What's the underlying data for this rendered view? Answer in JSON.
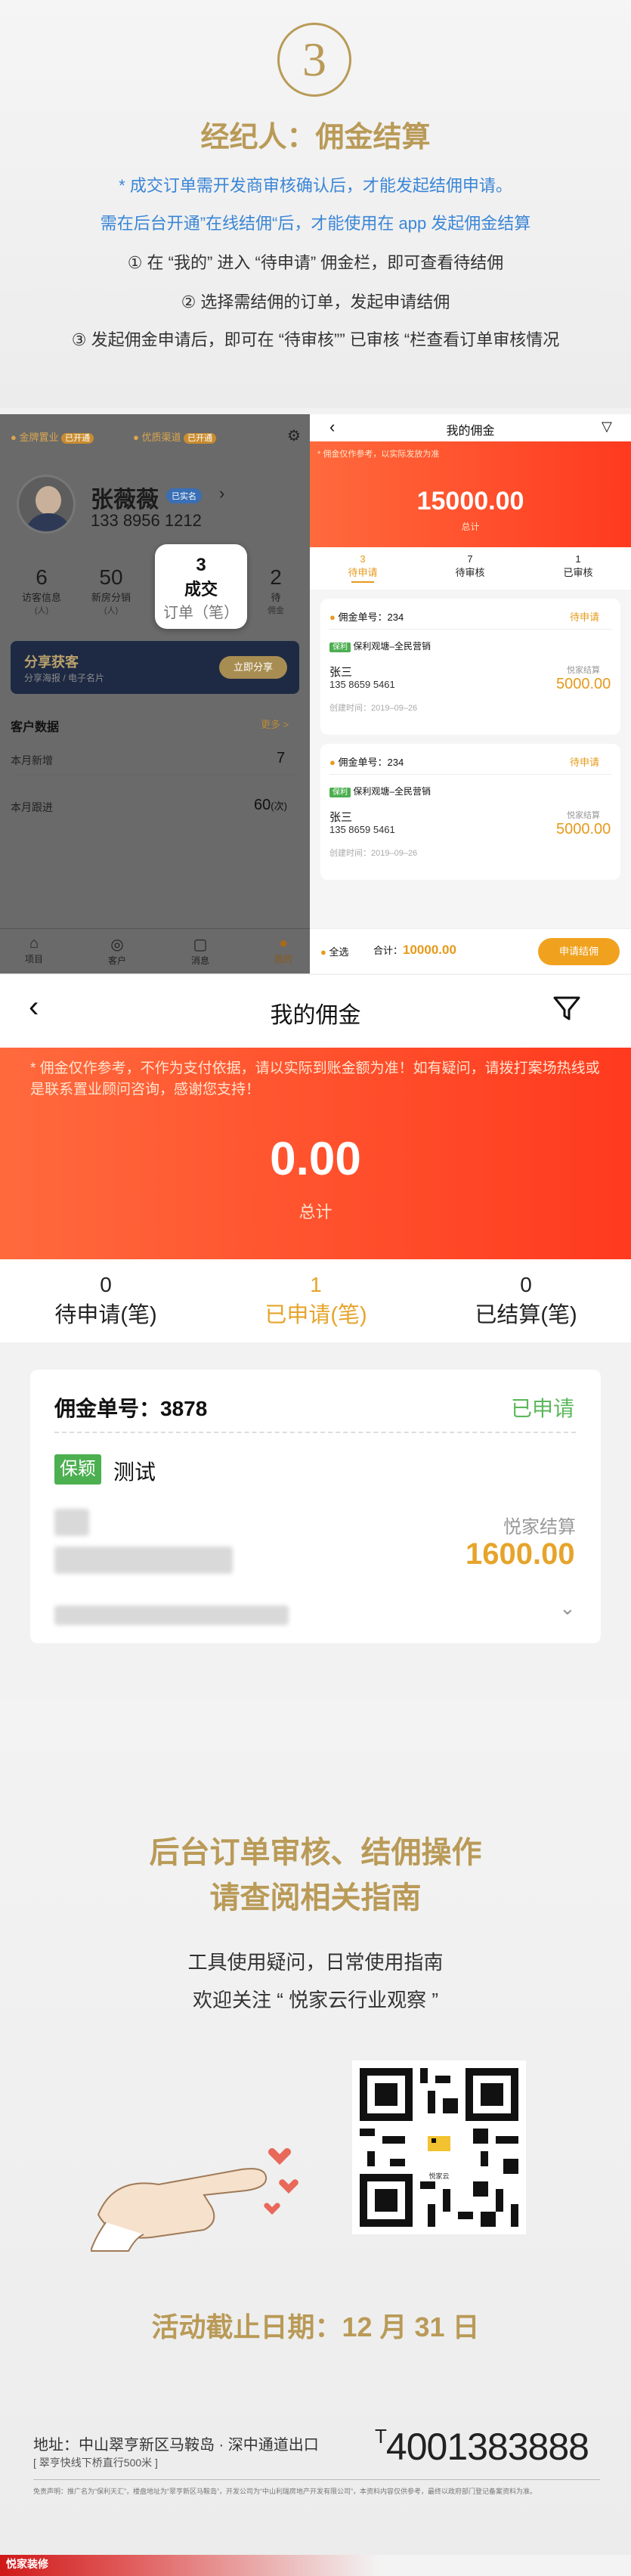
{
  "header": {
    "step_number": "3",
    "title": "经纪人：佣金结算",
    "note1": "* 成交订单需开发商审核确认后，才能发起结佣申请。",
    "note2": "需在后台开通”在线结佣“后，才能使用在 app 发起佣金结算",
    "step1": "① 在 “我的” 进入 “待申请” 佣金栏，即可查看待结佣",
    "step2": "② 选择需结佣的订单，发起申请结佣",
    "step3": "③ 发起佣金申请后，即可在 “待审核”” 已审核 “栏查看订单审核情况"
  },
  "left_phone": {
    "badge1": "金牌置业",
    "badge1_tag": "已开通",
    "badge2": "优质渠道",
    "badge2_tag": "已开通",
    "name": "张薇薇",
    "role_tag": "已实名",
    "phone": "133 8956 1212",
    "stats": [
      {
        "value": "6",
        "label": "访客信息",
        "sub": "(人)"
      },
      {
        "value": "50",
        "label": "新房分销",
        "sub": "(人)"
      },
      {
        "value": "3",
        "label": "成交",
        "sub": "订单（笔）"
      },
      {
        "value": "2",
        "label": "待",
        "sub": "佣金"
      }
    ],
    "share_title": "分享获客",
    "share_sub": "分享海报 / 电子名片",
    "share_btn": "立即分享",
    "customer_data": "客户数据",
    "more": "更多 >",
    "row1_label": "本月新增",
    "row1_value": "7",
    "row2_label": "本月跟进",
    "row2_value": "60",
    "row2_unit": "(次)",
    "tabs": [
      "项目",
      "客户",
      "消息",
      "我的"
    ]
  },
  "right_phone": {
    "title": "我的佣金",
    "notice": "* 佣金仅作参考，以实际发放为准",
    "amount": "15000.00",
    "amount_label": "总计",
    "tabs": [
      {
        "count": "3",
        "label": "待申请"
      },
      {
        "count": "7",
        "label": "待审核"
      },
      {
        "count": "1",
        "label": "已审核"
      }
    ],
    "items": [
      {
        "order": "佣金单号：234",
        "status": "待申请",
        "tag": "保利",
        "project": "保利观塘–全民营销",
        "client": "张三",
        "phone": "135 8659 5461",
        "pay_label": "悦家结算",
        "pay": "5000.00",
        "date": "创建时间：2019–09–26"
      },
      {
        "order": "佣金单号：234",
        "status": "待申请",
        "tag": "保利",
        "project": "保利观塘–全民营销",
        "client": "张三",
        "phone": "135 8659 5461",
        "pay_label": "悦家结算",
        "pay": "5000.00",
        "date": "创建时间：2019–09–26"
      }
    ],
    "select_all": "全选",
    "total_label": "合计：",
    "total": "10000.00",
    "apply_btn": "申请结佣"
  },
  "main": {
    "title": "我的佣金",
    "notice": "* 佣金仅作参考，不作为支付依据，请以实际到账金额为准！如有疑问，请拨打案场热线或是联系置业顾问咨询，感谢您支持！",
    "amount": "0.00",
    "amount_label": "总计",
    "tabs": [
      {
        "count": "0",
        "label": "待申请(笔)"
      },
      {
        "count": "1",
        "label": "已申请(笔)"
      },
      {
        "count": "0",
        "label": "已结算(笔)"
      }
    ],
    "order_label": "佣金单号：3878",
    "status": "已申请",
    "tag": "保颖",
    "project": "测试",
    "pay_label": "悦家结算",
    "pay": "1600.00",
    "accent": "#ff4a2a",
    "gold": "#e6a42b"
  },
  "footer": {
    "guide_line1": "后台订单审核、结佣操作",
    "guide_line2": "请查阅相关指南",
    "sub1": "工具使用疑问，日常使用指南",
    "sub2": "欢迎关注 “ 悦家云行业观察 ”",
    "qr_label": "悦家云",
    "deadline": "活动截止日期：12 月 31 日",
    "address": "地址：中山翠亨新区马鞍岛 · 深中通道出口",
    "address_sub": "[ 翠亨快线下桥直行500米 ]",
    "tel_prefix": "T",
    "tel": "4001383888",
    "disclaimer": "免责声明：推广名为“保利天汇”，楼盘地址为“翠亨新区马鞍岛”，开发公司为“中山利瑞房地产开发有限公司”，本资料内容仅供参考，最终以政府部门登记备案资料为准。",
    "logo_text": "悦家装修"
  }
}
